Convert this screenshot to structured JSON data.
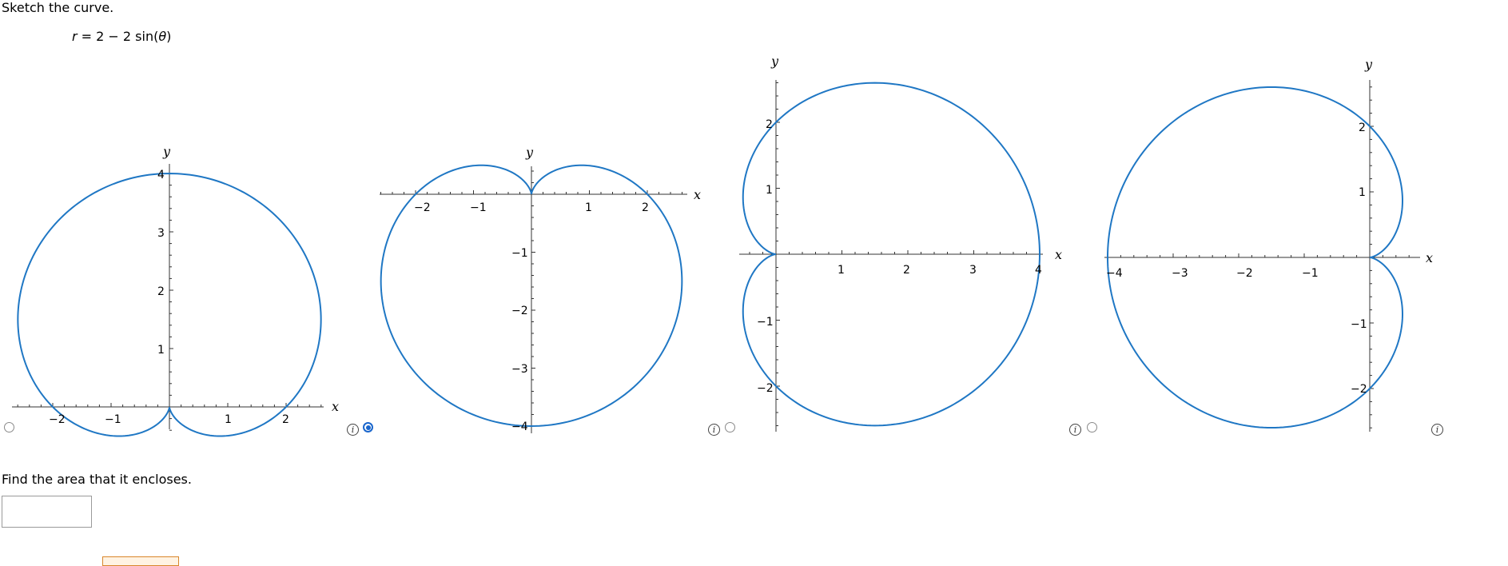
{
  "prompt": "Sketch the curve.",
  "equation": {
    "lhs": "r",
    "rhs_prefix": " = 2 − 2 sin(",
    "theta": "θ",
    "rhs_suffix": ")"
  },
  "options": [
    {
      "id": "a",
      "selected": false,
      "x_label": "x",
      "y_label": "y",
      "x_ticks": [
        "−2",
        "−1",
        "1",
        "2"
      ],
      "y_ticks": [
        "1",
        "2",
        "3",
        "4"
      ]
    },
    {
      "id": "b",
      "selected": true,
      "x_label": "x",
      "y_label": "y",
      "x_ticks": [
        "−2",
        "−1",
        "1",
        "2"
      ],
      "y_ticks": [
        "−1",
        "−2",
        "−3",
        "−4"
      ]
    },
    {
      "id": "c",
      "selected": false,
      "x_label": "x",
      "y_label": "y",
      "x_ticks": [
        "1",
        "2",
        "3",
        "4"
      ],
      "y_ticks": [
        "2",
        "1",
        "−1",
        "−2"
      ]
    },
    {
      "id": "d",
      "selected": false,
      "x_label": "x",
      "y_label": "y",
      "x_ticks": [
        "−4",
        "−3",
        "−2",
        "−1"
      ],
      "y_ticks": [
        "2",
        "1",
        "−1",
        "−2"
      ]
    }
  ],
  "colors": {
    "curve": "#1f77c4",
    "radio_selected": "#1a66cc",
    "axis": "#333333"
  },
  "info_icon_glyph": "i",
  "question2": "Find the area that it encloses.",
  "answer": {
    "value": ""
  }
}
